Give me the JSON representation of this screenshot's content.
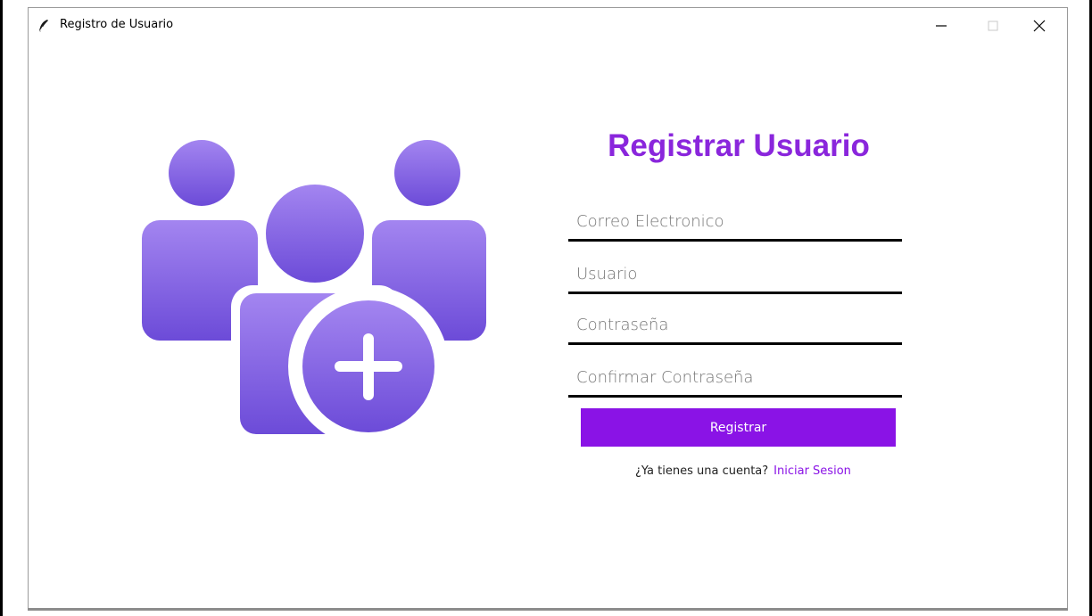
{
  "window": {
    "title": "Registro de Usuario",
    "controls": {
      "minimize": "minimize-icon",
      "maximize": "maximize-icon",
      "close": "close-icon"
    }
  },
  "hero": {
    "icon": "add-users-icon",
    "colors": {
      "top": "#a385f0",
      "bottom": "#6c4bd8"
    }
  },
  "form": {
    "heading": "Registrar Usuario",
    "fields": [
      {
        "placeholder": "Correo Electronico",
        "value": ""
      },
      {
        "placeholder": "Usuario",
        "value": ""
      },
      {
        "placeholder": "Contraseña",
        "value": ""
      },
      {
        "placeholder": "Confirmar Contraseña",
        "value": ""
      }
    ],
    "submit_label": "Registrar",
    "login_prompt": "¿Ya tienes una cuenta?",
    "login_link": "Iniciar Sesion"
  },
  "colors": {
    "accent": "#8a13e6",
    "heading": "#8a26dc",
    "underline": "#000000"
  }
}
